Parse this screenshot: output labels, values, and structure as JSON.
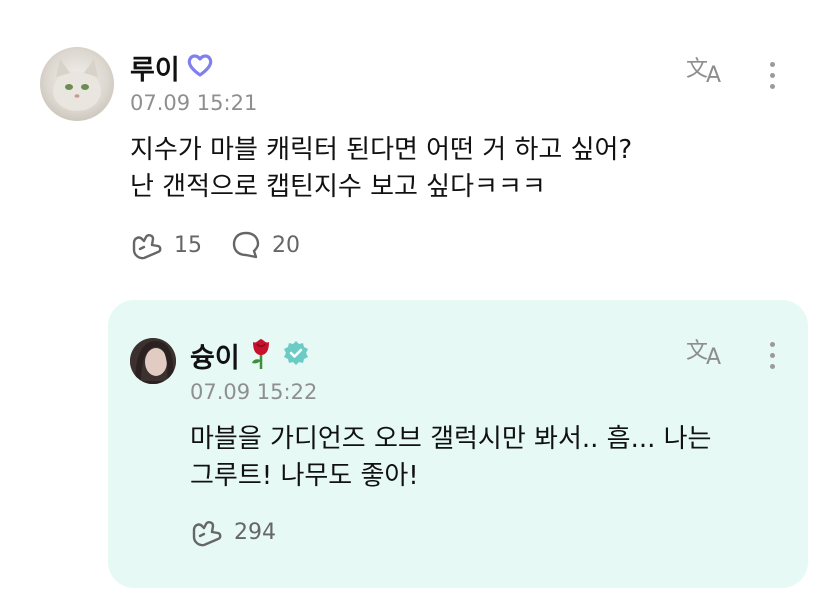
{
  "post": {
    "author": "루이",
    "badge_icon": "heart-badge-icon",
    "timestamp": "07.09 15:21",
    "content": "지수가 마블 캐릭터 된다면 어떤 거 하고 싶어?\n난 갠적으로 캡틴지수 보고 싶다ㅋㅋㅋ",
    "likes": "15",
    "comments": "20"
  },
  "reply": {
    "author": "슝이",
    "emoji": "🌹",
    "badge_icon": "verified-badge-icon",
    "timestamp": "07.09 15:22",
    "content": "마블을 가디언즈 오브 갤럭시만 봐서.. 흠... 나는\n그루트! 나무도 좋아!",
    "likes": "294"
  },
  "colors": {
    "reply_background": "#e6f9f5",
    "verified": "#6ccbc4",
    "heart_badge": "#7f7ff0",
    "rose": "#c8102e"
  }
}
